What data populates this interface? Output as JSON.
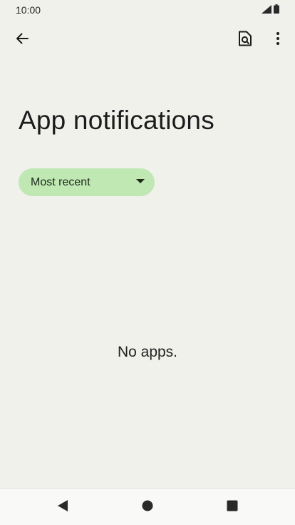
{
  "status_bar": {
    "time": "10:00",
    "signal_icon": "signal-icon",
    "battery_icon": "battery-icon"
  },
  "app_bar": {
    "back_icon": "arrow-back-icon",
    "search_icon": "search-in-page-icon",
    "more_icon": "more-vert-icon"
  },
  "page": {
    "title": "App notifications",
    "filter": {
      "selected": "Most recent",
      "caret_icon": "caret-down-icon"
    },
    "empty_message": "No apps."
  },
  "nav_bar": {
    "back_icon": "nav-back-triangle-icon",
    "home_icon": "nav-home-circle-icon",
    "recents_icon": "nav-recents-square-icon"
  },
  "colors": {
    "background": "#f1f1ec",
    "chip": "#bfe8b3",
    "nav_bar": "#f9f9f7",
    "text": "#1c1c1c"
  }
}
